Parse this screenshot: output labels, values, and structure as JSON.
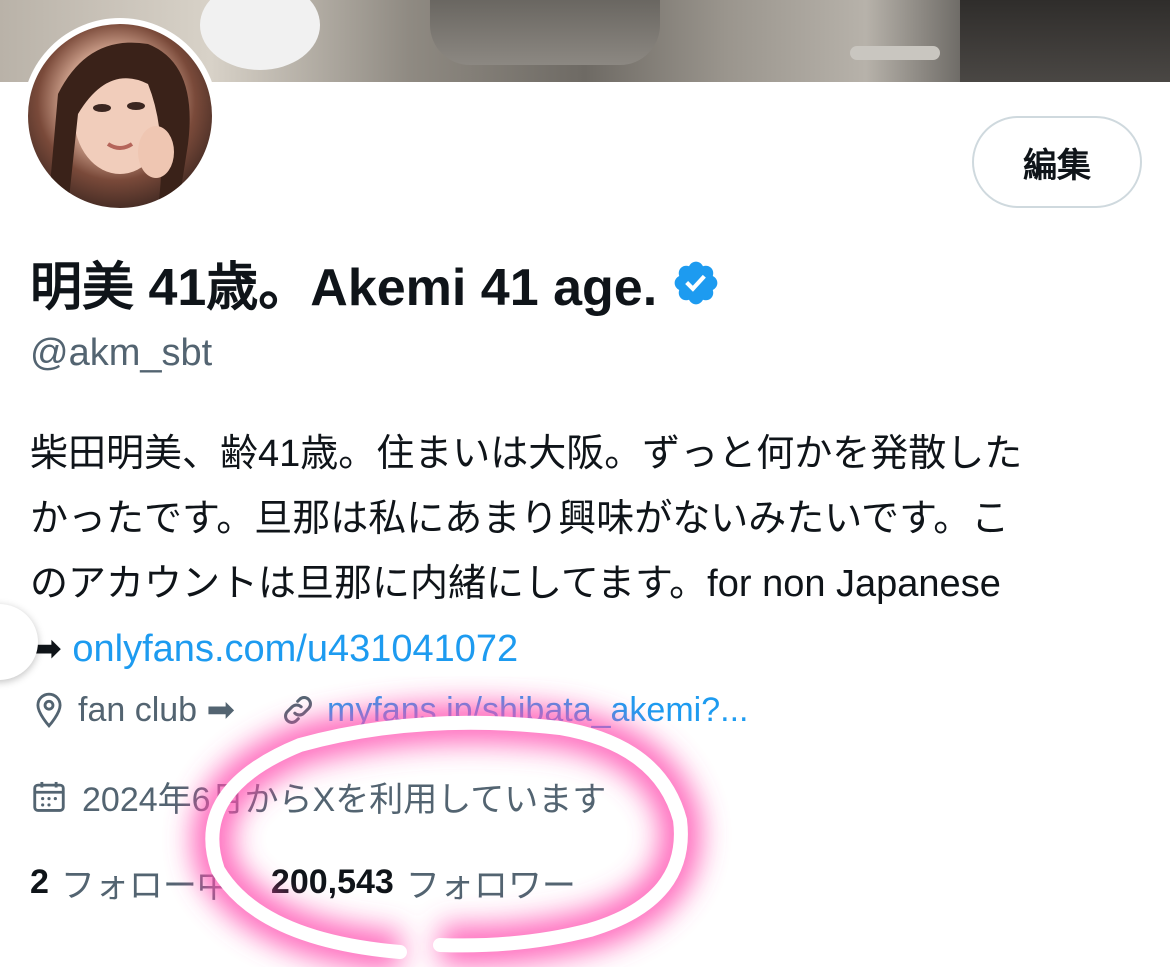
{
  "profile": {
    "edit_label": "編集",
    "display_name": "明美 41歳。Akemi 41 age.",
    "handle": "@akm_sbt",
    "bio_lines": [
      "柴田明美、齢41歳。住まいは大阪。ずっと何かを発散した",
      "かったです。旦那は私にあまり興味がないみたいです。こ",
      "のアカウントは旦那に内緒にしてます。for non Japanese"
    ],
    "bio_arrow": "➡",
    "bio_link": "onlyfans.com/u431041072",
    "location": "fan club ➡",
    "website": "myfans.jp/shibata_akemi?...",
    "joined": "2024年6月からXを利用しています",
    "following_count": "2",
    "following_label": "フォロー中",
    "followers_count": "200,543",
    "followers_label": "フォロワー"
  },
  "icons": {
    "verified": "verified-badge-icon",
    "location": "location-pin-icon",
    "link": "link-icon",
    "calendar": "calendar-icon"
  },
  "colors": {
    "accent": "#1d9bf0",
    "secondary_text": "#536471",
    "highlight": "#ff5fb8"
  }
}
